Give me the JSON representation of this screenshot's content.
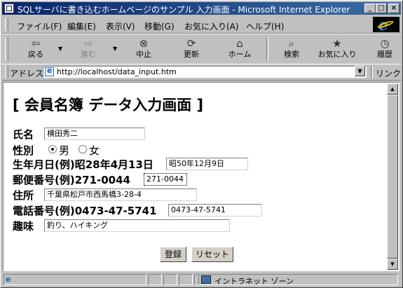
{
  "window": {
    "title": "SQLサーバに書き込むホームページのサンプル 入力画面 - Microsoft Internet Explorer",
    "controls": [
      "_",
      "□",
      "×"
    ]
  },
  "menu": [
    "ファイル(F)",
    "編集(E)",
    "表示(V)",
    "移動(G)",
    "お気に入り(A)",
    "ヘルプ(H)"
  ],
  "toolbar": {
    "back": "戻る",
    "forward": "進む",
    "stop": "中止",
    "refresh": "更新",
    "home": "ホーム",
    "search": "検索",
    "favorites": "お気に入り",
    "history": "履歴"
  },
  "address": {
    "label": "アドレス",
    "url": "http://localhost/data_input.htm",
    "links": "リンク"
  },
  "page": {
    "heading": "[ 会員名簿 データ入力画面 ]",
    "name": {
      "label": "氏名",
      "value": "横田秀二"
    },
    "sex": {
      "label": "性別",
      "male": "男",
      "female": "女",
      "selected": "男"
    },
    "birthday": {
      "label": "生年月日(例)昭28年4月13日",
      "value": "昭50年12月9日"
    },
    "zip": {
      "label": "郵便番号(例)271-0044",
      "value": "271-0044"
    },
    "address": {
      "label": "住所",
      "value": "千葉県松戸市西馬橋3-28-4"
    },
    "phone": {
      "label": "電話番号(例)0473-47-5741",
      "value": "0473-47-5741"
    },
    "hobby": {
      "label": "趣味",
      "value": "釣り、ハイキング"
    },
    "submit": "登録",
    "reset": "リセット"
  },
  "status": {
    "zone": "イントラネット ゾーン"
  }
}
